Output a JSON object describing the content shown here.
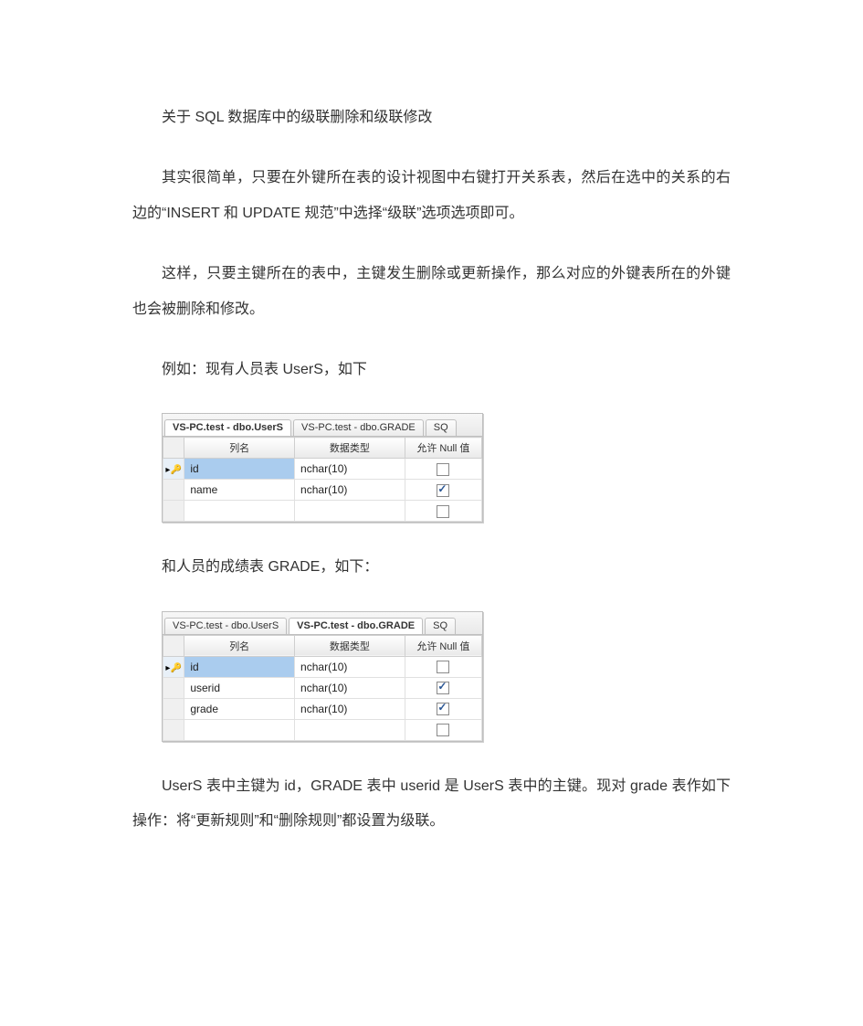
{
  "paragraphs": {
    "p1": "关于 SQL 数据库中的级联删除和级联修改",
    "p2": "其实很简单，只要在外键所在表的设计视图中右键打开关系表，然后在选中的关系的右边的“INSERT 和 UPDATE 规范”中选择“级联”选项选项即可。",
    "p3": "这样，只要主键所在的表中，主键发生删除或更新操作，那么对应的外键表所在的外键也会被删除和修改。",
    "p4": "例如：现有人员表 UserS，如下",
    "p5": "和人员的成绩表 GRADE，如下：",
    "p6": "UserS 表中主键为 id，GRADE 表中 userid 是 UserS 表中的主键。现对 grade 表作如下操作：将“更新规则”和“删除规则”都设置为级联。"
  },
  "designer_shared": {
    "headers": {
      "colname": "列名",
      "datatype": "数据类型",
      "allownull": "允许 Null 值"
    },
    "tabs": {
      "users": "VS-PC.test - dbo.UserS",
      "grade": "VS-PC.test - dbo.GRADE",
      "sq": "SQ"
    }
  },
  "table_users": {
    "active_tab_index": 0,
    "rows": [
      {
        "pk": true,
        "name": "id",
        "type": "nchar(10)",
        "allow_null": false
      },
      {
        "pk": false,
        "name": "name",
        "type": "nchar(10)",
        "allow_null": true
      }
    ]
  },
  "table_grade": {
    "active_tab_index": 1,
    "rows": [
      {
        "pk": true,
        "name": "id",
        "type": "nchar(10)",
        "allow_null": false
      },
      {
        "pk": false,
        "name": "userid",
        "type": "nchar(10)",
        "allow_null": true
      },
      {
        "pk": false,
        "name": "grade",
        "type": "nchar(10)",
        "allow_null": true
      }
    ]
  }
}
